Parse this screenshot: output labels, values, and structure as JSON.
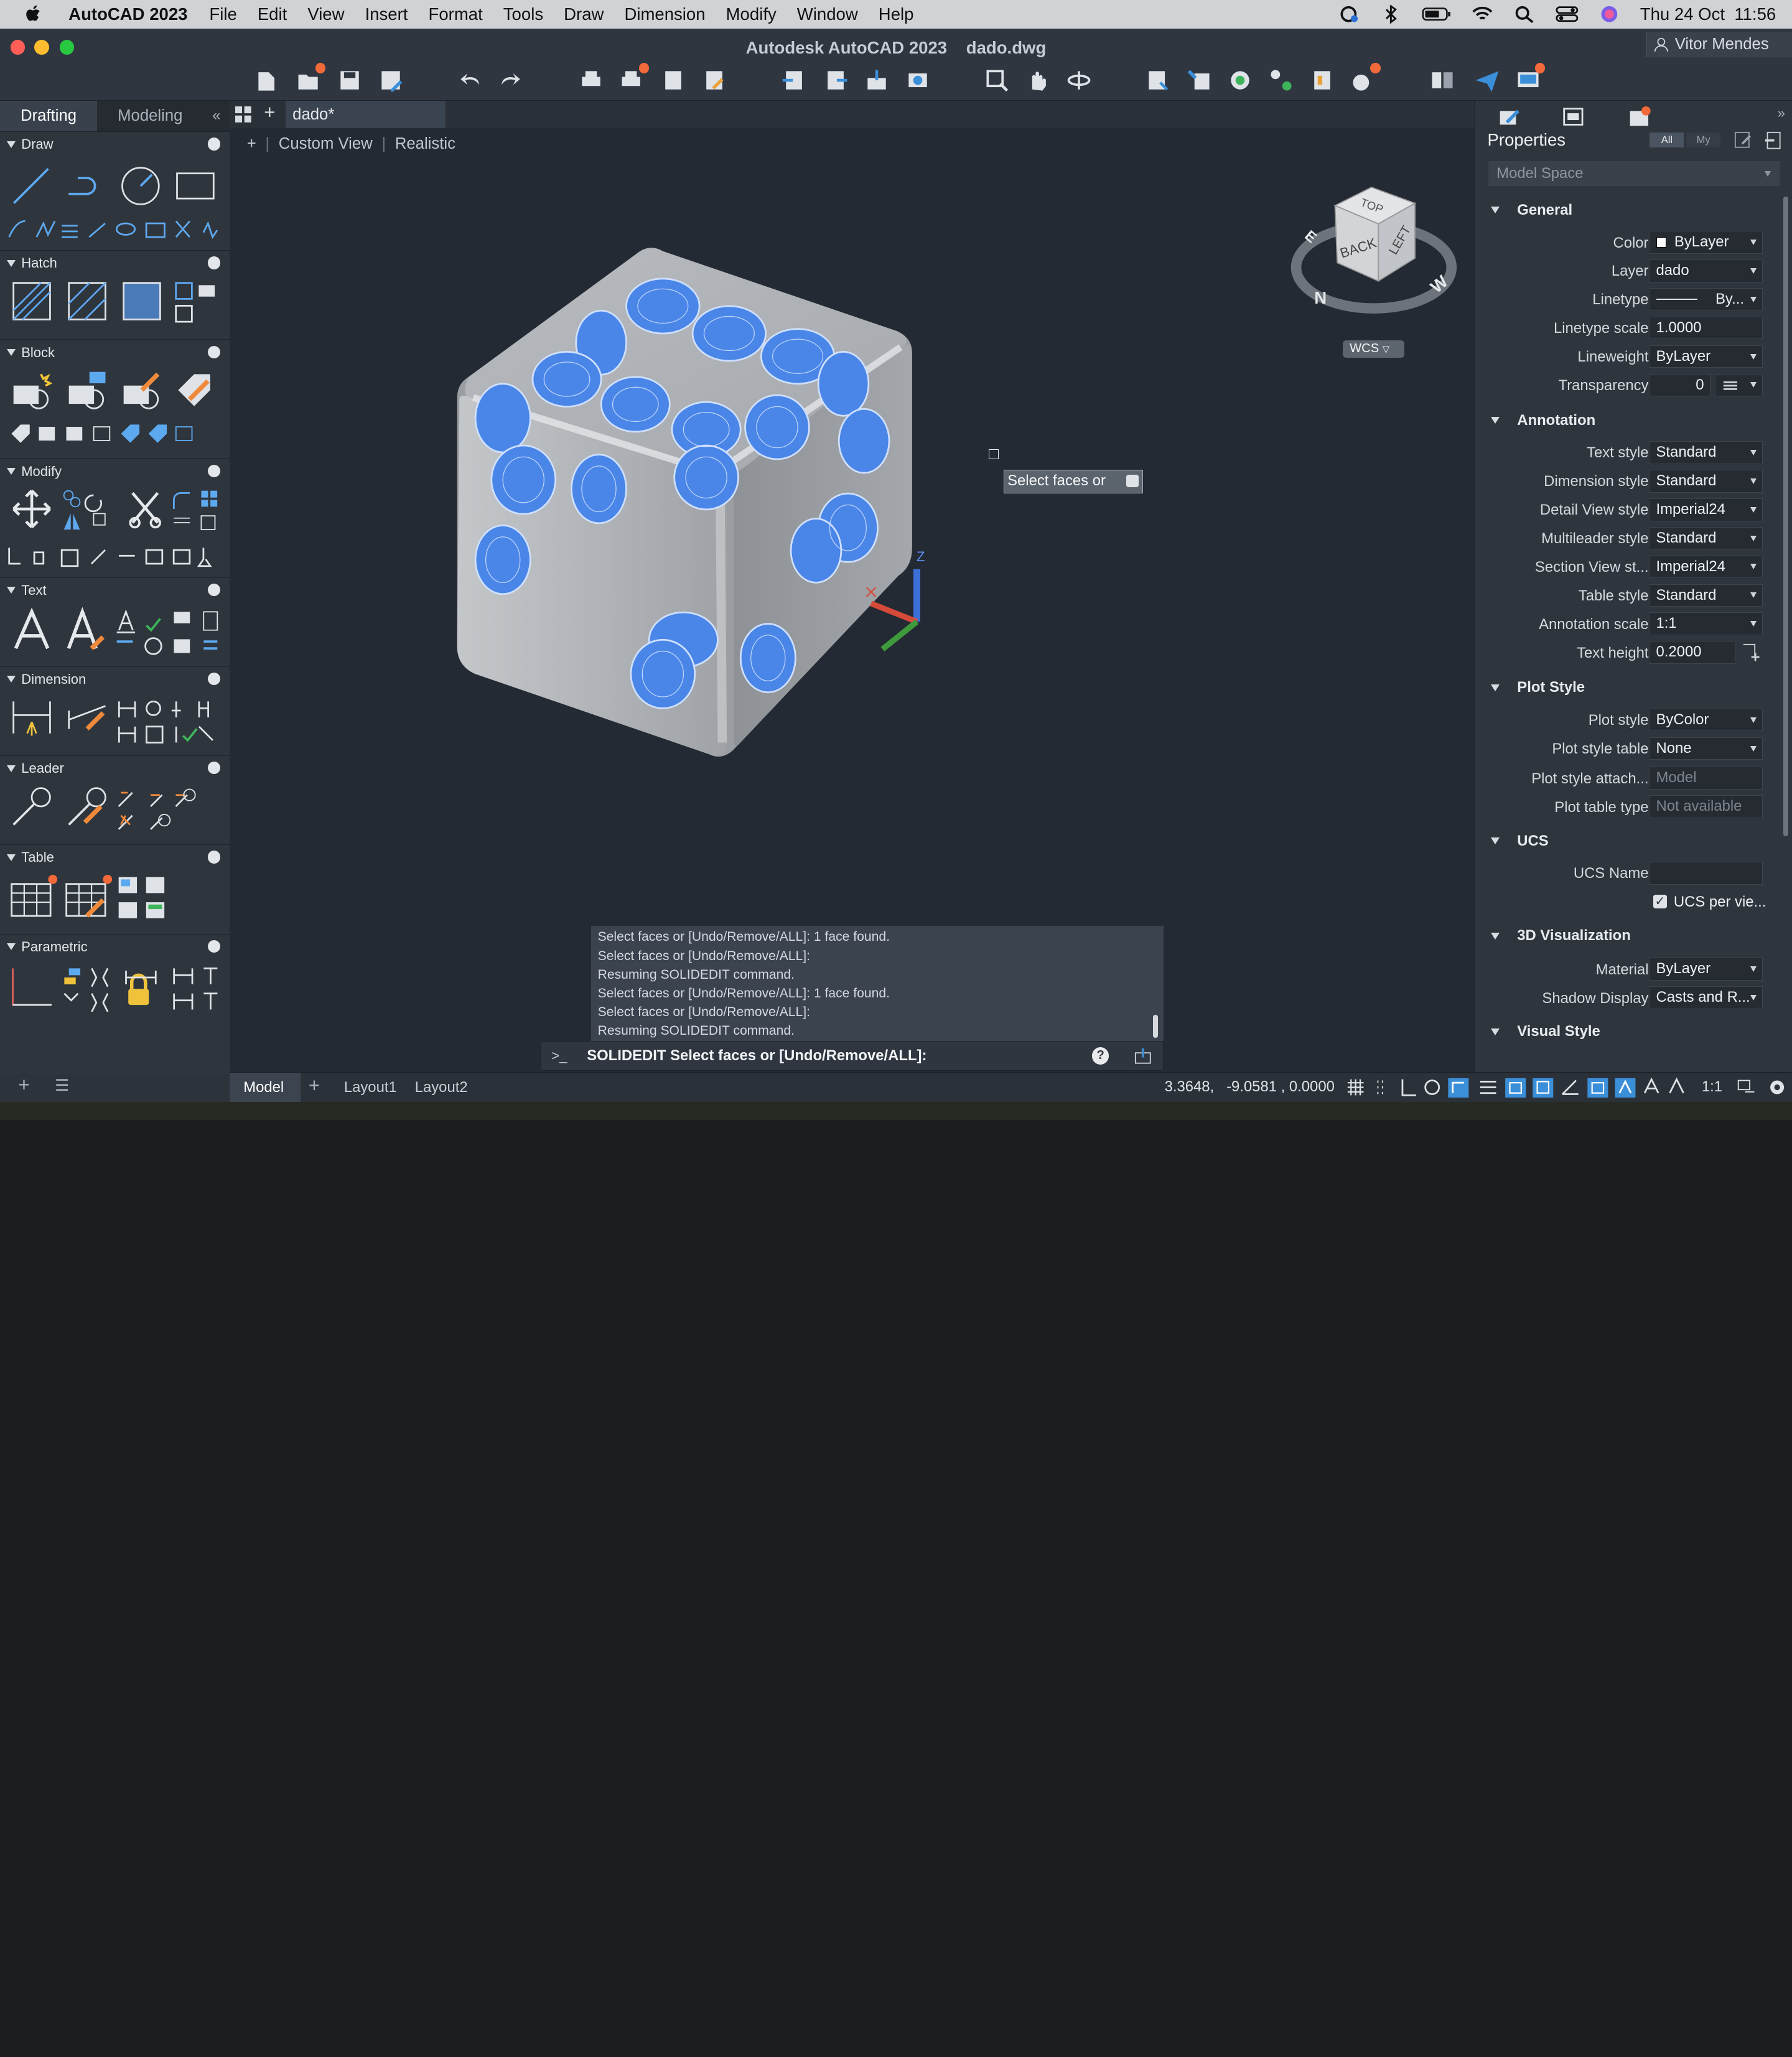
{
  "menubar": {
    "app": "AutoCAD 2023",
    "items": [
      "File",
      "Edit",
      "View",
      "Insert",
      "Format",
      "Tools",
      "Draw",
      "Dimension",
      "Modify",
      "Window",
      "Help"
    ],
    "clock": "Thu 24 Oct  11:56"
  },
  "title": {
    "window": "Autodesk AutoCAD 2023    dado.dwg",
    "user": "Vitor Mendes"
  },
  "left_panel": {
    "tabs": [
      "Drafting",
      "Modeling"
    ],
    "sections": [
      "Draw",
      "Hatch",
      "Block",
      "Modify",
      "Text",
      "Dimension",
      "Leader",
      "Table",
      "Parametric"
    ]
  },
  "document": {
    "tab": "dado*",
    "view_labels": [
      "+",
      "Custom View",
      "Realistic"
    ],
    "wcs": "WCS",
    "tooltip": "Select faces or",
    "axis_z": "Z"
  },
  "viewcube": {
    "top": "TOP",
    "back": "BACK",
    "left": "LEFT",
    "n": "N",
    "w": "W",
    "e": "E"
  },
  "command": {
    "history": [
      "Select faces or [Undo/Remove/ALL]: 1 face found.",
      "Select faces or [Undo/Remove/ALL]:",
      "Resuming SOLIDEDIT command.",
      "Select faces or [Undo/Remove/ALL]: 1 face found.",
      "Select faces or [Undo/Remove/ALL]:",
      "Resuming SOLIDEDIT command."
    ],
    "prompt_symbol": ">_",
    "current": "SOLIDEDIT Select faces or [Undo/Remove/ALL]:"
  },
  "properties": {
    "title": "Properties",
    "filters": [
      "All",
      "My"
    ],
    "selection": "Model Space",
    "general": {
      "header": "General",
      "color": [
        "Color",
        "ByLayer"
      ],
      "layer": [
        "Layer",
        "dado"
      ],
      "linetype": [
        "Linetype",
        "By..."
      ],
      "linetype_scale": [
        "Linetype scale",
        "1.0000"
      ],
      "lineweight": [
        "Lineweight",
        "ByLayer"
      ],
      "transparency": [
        "Transparency",
        "0"
      ]
    },
    "annotation": {
      "header": "Annotation",
      "text_style": [
        "Text style",
        "Standard"
      ],
      "dimension_style": [
        "Dimension style",
        "Standard"
      ],
      "detail_view_style": [
        "Detail View style",
        "Imperial24"
      ],
      "multileader_style": [
        "Multileader style",
        "Standard"
      ],
      "section_view_style": [
        "Section View st...",
        "Imperial24"
      ],
      "table_style": [
        "Table style",
        "Standard"
      ],
      "annotation_scale": [
        "Annotation scale",
        "1:1"
      ],
      "text_height": [
        "Text height",
        "0.2000"
      ]
    },
    "plot_style": {
      "header": "Plot Style",
      "plot_style": [
        "Plot style",
        "ByColor"
      ],
      "plot_style_table": [
        "Plot style table",
        "None"
      ],
      "plot_style_attach": [
        "Plot style attach...",
        "Model"
      ],
      "plot_table_type": [
        "Plot table type",
        "Not available"
      ]
    },
    "ucs": {
      "header": "UCS",
      "ucs_name": [
        "UCS Name",
        ""
      ],
      "ucs_per_view": "UCS per vie..."
    },
    "viz3d": {
      "header": "3D Visualization",
      "material": [
        "Material",
        "ByLayer"
      ],
      "shadow_display": [
        "Shadow Display",
        "Casts and R..."
      ]
    },
    "visual_style": {
      "header": "Visual Style"
    }
  },
  "status": {
    "tabs": [
      "Model",
      "Layout1",
      "Layout2"
    ],
    "coords": "3.3648,   -9.0581 , 0.0000",
    "scale": "1:1"
  }
}
